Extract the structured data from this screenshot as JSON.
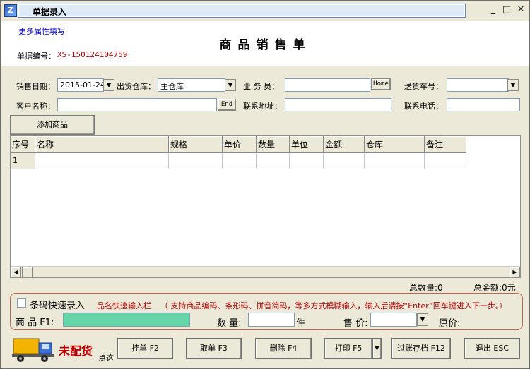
{
  "window": {
    "title": "单据录入",
    "controls": {
      "minimize": "_",
      "maximize": "□",
      "close": "✕"
    }
  },
  "header": {
    "more_link": "更多属性填写",
    "doc_title": "商品销售单",
    "doc_no_label": "单据编号：",
    "doc_no": "XS-150124104759"
  },
  "form": {
    "sale_date_label": "销售日期：",
    "sale_date_value": "2015-01-24",
    "warehouse_label": "出货仓库：",
    "warehouse_value": "主仓库",
    "salesman_label": "业 务 员：",
    "salesman_value": "",
    "home_button": "Home",
    "vehicle_label": "送货车号：",
    "vehicle_value": "",
    "customer_label": "客户名称：",
    "customer_value": "",
    "end_button": "End",
    "address_label": "联系地址：",
    "address_value": "",
    "phone_label": "联系电话：",
    "phone_value": "",
    "add_product_button": "添加商品"
  },
  "grid": {
    "columns": [
      "序号",
      "名称",
      "规格",
      "单价",
      "数量",
      "单位",
      "金额",
      "仓库",
      "备注"
    ],
    "rows": [
      [
        "1",
        "",
        "",
        "",
        "",
        "",
        "",
        "",
        ""
      ]
    ]
  },
  "totals": {
    "total_qty_label": "总数量:0",
    "total_amount_label": "总金额:0元"
  },
  "quick_entry": {
    "barcode_label": "条码快速录入",
    "hint_title": "品名快速输入栏",
    "hint_text": "（ 支持商品编码、条形码、拼音简码，等多方式模糊输入，输入后请按“Enter”回车键进入下一步。）",
    "product_label": "商 品 F1:",
    "product_value": "",
    "qty_label": "数 量:",
    "qty_value": "",
    "qty_unit": "件",
    "price_label": "售 价:",
    "price_value": "",
    "orig_price_label": "原价:"
  },
  "footer": {
    "not_delivered": "未配货",
    "click_hint": "点这",
    "buttons": {
      "hold": "挂单 F2",
      "retrieve": "取单 F3",
      "delete": "删除 F4",
      "print": "打印 F5",
      "post_save": "过账存档 F12",
      "exit": "退出 ESC"
    }
  },
  "icons": {
    "app": "app-icon",
    "dropdown": "chevron-down-icon",
    "truck": "truck-icon"
  },
  "colors": {
    "window_bg": "#ECE9D8",
    "accent_red": "#b00000",
    "product_field": "#66d6a8",
    "panel_border": "#c0654e"
  }
}
